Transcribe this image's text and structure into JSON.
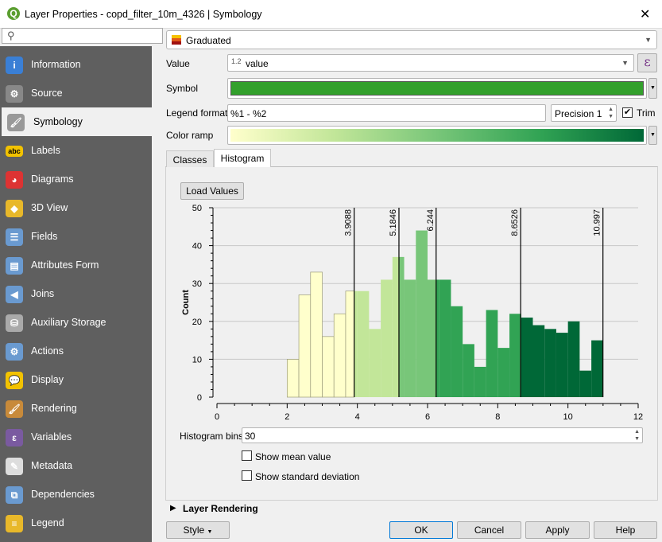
{
  "window": {
    "title": "Layer Properties - copd_filter_10m_4326 | Symbology",
    "close": "✕"
  },
  "search": {
    "placeholder": "",
    "icon": "search-icon"
  },
  "sidebar": {
    "items": [
      {
        "label": "Information",
        "icon": "i",
        "color": "#3a7fd5"
      },
      {
        "label": "Source",
        "icon": "⚙",
        "color": "#888"
      },
      {
        "label": "Symbology",
        "icon": "🖌",
        "color": "#999"
      },
      {
        "label": "Labels",
        "icon": "abc",
        "color": "#f2c200"
      },
      {
        "label": "Diagrams",
        "icon": "◕",
        "color": "#d33"
      },
      {
        "label": "3D View",
        "icon": "◆",
        "color": "#e8b82a"
      },
      {
        "label": "Fields",
        "icon": "☰",
        "color": "#6a9ad0"
      },
      {
        "label": "Attributes Form",
        "icon": "▤",
        "color": "#6a9ad0"
      },
      {
        "label": "Joins",
        "icon": "◀",
        "color": "#6a9ad0"
      },
      {
        "label": "Auxiliary Storage",
        "icon": "⛁",
        "color": "#aaa"
      },
      {
        "label": "Actions",
        "icon": "⚙",
        "color": "#6a9ad0"
      },
      {
        "label": "Display",
        "icon": "💬",
        "color": "#f2c200"
      },
      {
        "label": "Rendering",
        "icon": "🖌",
        "color": "#c88a3a"
      },
      {
        "label": "Variables",
        "icon": "ε",
        "color": "#7a5aa0"
      },
      {
        "label": "Metadata",
        "icon": "✎",
        "color": "#ddd"
      },
      {
        "label": "Dependencies",
        "icon": "⧉",
        "color": "#6a9ad0"
      },
      {
        "label": "Legend",
        "icon": "≡",
        "color": "#e8b82a"
      }
    ],
    "selected": "Symbology"
  },
  "renderer": {
    "type": "Graduated"
  },
  "form": {
    "value_label": "Value",
    "value_prefix": "1.2",
    "value": "value",
    "expr_button": "ε",
    "symbol_label": "Symbol",
    "symbol_color": "#33a02c",
    "legend_format_label": "Legend format",
    "legend_format": "%1 - %2",
    "precision": "Precision 1",
    "trim_label": "Trim",
    "trim_checked": true,
    "color_ramp_label": "Color ramp",
    "ramp_colors": [
      "#ffffcc",
      "#c2e699",
      "#78c679",
      "#31a354",
      "#006837"
    ]
  },
  "tabs": [
    {
      "label": "Classes"
    },
    {
      "label": "Histogram",
      "active": true
    }
  ],
  "histogram": {
    "load_values": "Load Values",
    "bins_label": "Histogram bins",
    "bins": "30",
    "show_mean": "Show mean value",
    "show_mean_checked": false,
    "show_std": "Show standard deviation",
    "show_std_checked": false
  },
  "chart_data": {
    "type": "bar",
    "ylabel": "Count",
    "xlabel": "",
    "xlim": [
      0,
      12
    ],
    "ylim": [
      0,
      50
    ],
    "xticks": [
      "0",
      "2",
      "4",
      "6",
      "8",
      "10",
      "12"
    ],
    "yticks": [
      "0",
      "10",
      "20",
      "30",
      "40",
      "50"
    ],
    "bin_range": [
      2.0,
      11.0
    ],
    "counts": [
      10,
      27,
      33,
      16,
      22,
      28,
      28,
      18,
      31,
      37,
      31,
      44,
      31,
      31,
      24,
      14,
      8,
      23,
      13,
      22,
      21,
      19,
      18,
      17,
      20,
      7,
      15
    ],
    "breaks": [
      3.9088,
      5.1846,
      6.244,
      8.6526,
      10.997
    ],
    "break_labels": [
      "3.9088",
      "5.1846",
      "6.244",
      "8.6526",
      "10.997"
    ],
    "class_colors": [
      "#ffffcc",
      "#c2e699",
      "#78c679",
      "#31a354",
      "#006837"
    ],
    "grid": true
  },
  "layer_rendering": "Layer Rendering",
  "footer": {
    "style": "Style",
    "ok": "OK",
    "cancel": "Cancel",
    "apply": "Apply",
    "help": "Help"
  }
}
